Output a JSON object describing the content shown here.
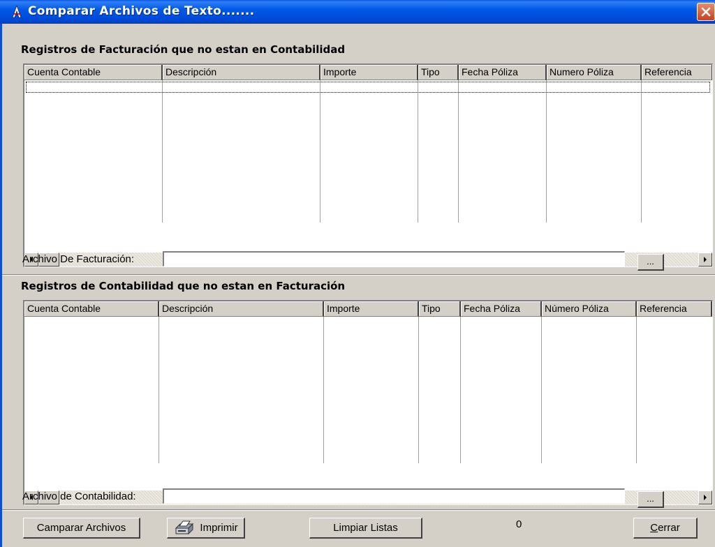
{
  "window": {
    "title": "Comparar Archivos de Texto.......",
    "icon": "app-icon",
    "close_icon": "close-icon"
  },
  "billing_section": {
    "title": "Registros de Facturación que no estan en Contabilidad",
    "columns": [
      "Cuenta Contable",
      "Descripción",
      "Importe",
      "Tipo",
      "Fecha Póliza",
      "Numero Póliza",
      "Referencia"
    ],
    "rows": [],
    "file_label": "Archivo De Facturación:",
    "file_value": "",
    "browse_label": "..."
  },
  "accounting_section": {
    "title": "Registros de Contabilidad que no estan en Facturación",
    "columns": [
      "Cuenta Contable",
      "Descripción",
      "Importe",
      "Tipo",
      "Fecha Póliza",
      "Número Póliza",
      "Referencia"
    ],
    "rows": [],
    "file_label": "Archivo de Contabilidad:",
    "file_value": "",
    "browse_label": "..."
  },
  "toolbar": {
    "compare_label": "Camparar Archivos",
    "print_label": "Imprimir",
    "print_icon": "printer-icon",
    "clear_label": "Limpiar Listas",
    "count": "0",
    "close_label_underlined": "C",
    "close_label_rest": "errar"
  }
}
